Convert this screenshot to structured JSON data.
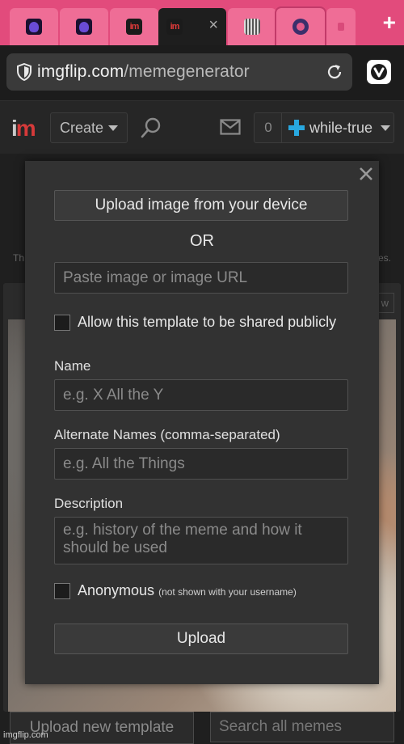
{
  "browser": {
    "url_domain": "imgflip.com",
    "url_path": "/memegenerator",
    "tabs": [
      {
        "icon": "purple-devil-favicon"
      },
      {
        "icon": "purple-devil-favicon"
      },
      {
        "icon": "imgflip-favicon",
        "text": "im"
      },
      {
        "icon": "imgflip-favicon",
        "text": "im",
        "active": true,
        "close": "×"
      },
      {
        "icon": "film-strip-favicon"
      },
      {
        "icon": "orb-favicon"
      },
      {
        "icon": "partial-favicon"
      }
    ],
    "new_tab": "+"
  },
  "sitenav": {
    "logo_i": "i",
    "logo_m": "m",
    "create_label": "Create",
    "notif_count": "0",
    "username": "while-true"
  },
  "background": {
    "text_left": "Th",
    "text_right": "es.",
    "panel_button": "w",
    "upload_new_template": "Upload new template",
    "search_placeholder": "Search all memes",
    "watermark": "imgflip.com"
  },
  "modal": {
    "upload_device_label": "Upload image from your device",
    "or_label": "OR",
    "url_placeholder": "Paste image or image URL",
    "share_public_label": "Allow this template to be shared publicly",
    "name_label": "Name",
    "name_placeholder": "e.g. X All the Y",
    "alt_names_label": "Alternate Names (comma-separated)",
    "alt_names_placeholder": "e.g. All the Things",
    "description_label": "Description",
    "description_placeholder": "e.g. history of the meme and how it should be used",
    "anonymous_label": "Anonymous",
    "anonymous_note": "(not shown with your username)",
    "upload_label": "Upload"
  },
  "colors": {
    "tabstrip": "#e24b7c",
    "accent_blue": "#28a8e0",
    "imgflip_red": "#d63a3a"
  }
}
